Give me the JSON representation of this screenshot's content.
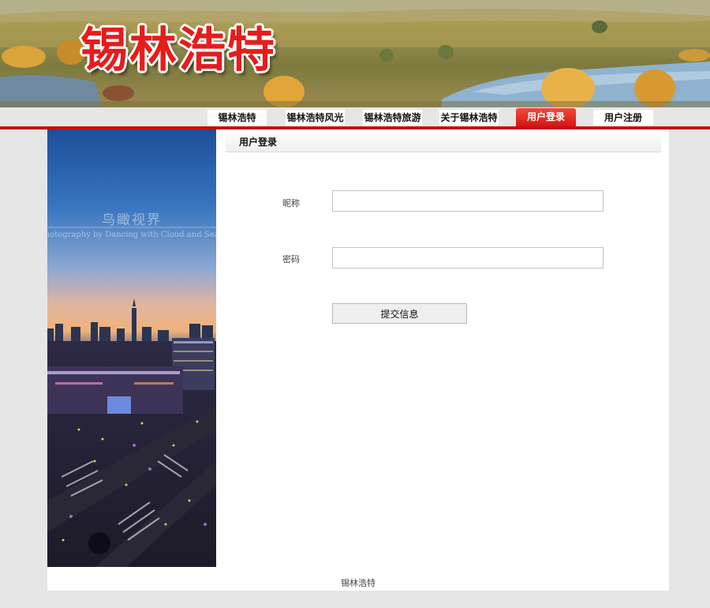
{
  "header": {
    "logo_text": "锡林浩特"
  },
  "nav": {
    "items": [
      {
        "label": "锡林浩特"
      },
      {
        "label": "锡林浩特风光"
      },
      {
        "label": "锡林浩特旅游"
      },
      {
        "label": "关于锡林浩特"
      },
      {
        "label": "用户登录"
      },
      {
        "label": "用户注册"
      }
    ]
  },
  "sidebar": {
    "photo_watermark": "鸟瞰视界",
    "photo_caption": "Photography by Dancing with Cloud and Sea"
  },
  "login": {
    "panel_title": "用户登录",
    "nickname_label": "昵称",
    "nickname_value": "",
    "password_label": "密码",
    "password_value": "",
    "submit_label": "提交信息"
  },
  "footer": {
    "text": "锡林浩特"
  },
  "colors": {
    "brand_red": "#c90f0f",
    "active_tab": "#e02a22",
    "page_bg": "#e6e6e6"
  }
}
